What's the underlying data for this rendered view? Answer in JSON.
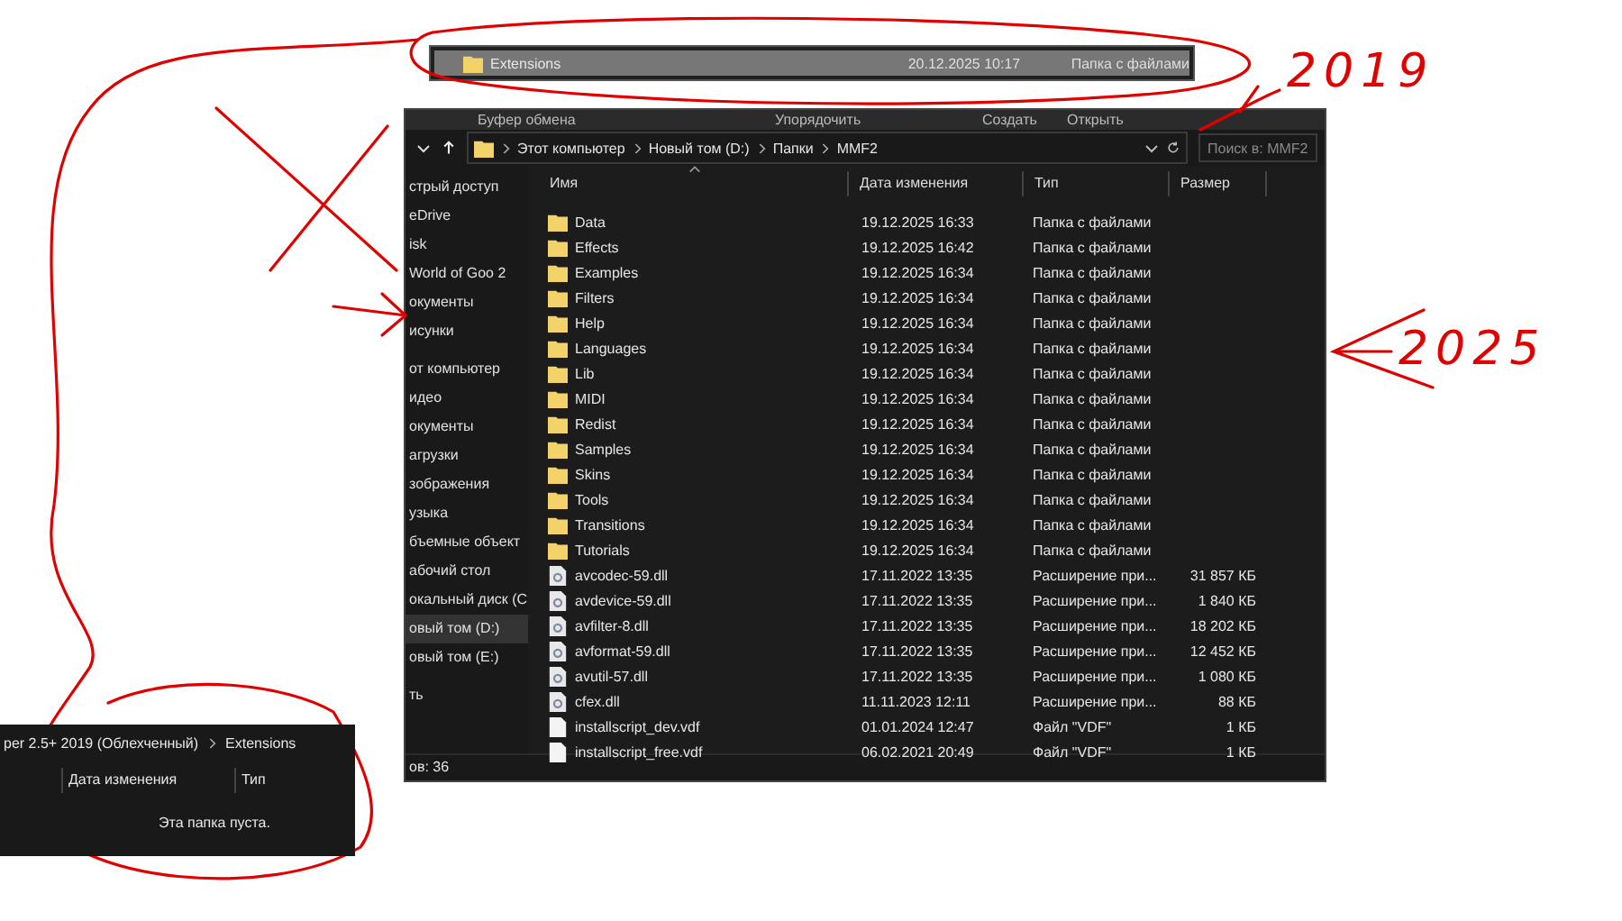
{
  "top_strip": {
    "name": "Extensions",
    "date": "20.12.2025 10:17",
    "type": "Папка с файлами",
    "selected": true
  },
  "annotations": [
    "2019",
    "2025"
  ],
  "main_window": {
    "ribbon_groups": [
      "Буфер обмена",
      "Упорядочить",
      "Создать",
      "Открыть"
    ],
    "breadcrumb": [
      "Этот компьютер",
      "Новый том (D:)",
      "Папки",
      "MMF2"
    ],
    "search": {
      "placeholder": "Поиск в: MMF2"
    },
    "sidebar": [
      {
        "label": "стрый доступ",
        "selected": false
      },
      {
        "label": "eDrive",
        "selected": false
      },
      {
        "label": "isk",
        "selected": false
      },
      {
        "label": "World of Goo 2",
        "selected": false
      },
      {
        "label": "окументы",
        "selected": false
      },
      {
        "label": "исунки",
        "selected": false
      },
      {
        "label": "от компьютер",
        "selected": false
      },
      {
        "label": "идео",
        "selected": false
      },
      {
        "label": "окументы",
        "selected": false
      },
      {
        "label": "агрузки",
        "selected": false
      },
      {
        "label": "зображения",
        "selected": false
      },
      {
        "label": "узыка",
        "selected": false
      },
      {
        "label": "бъемные объект",
        "selected": false
      },
      {
        "label": "абочий стол",
        "selected": false
      },
      {
        "label": "окальный диск (С",
        "selected": false
      },
      {
        "label": "овый том (D:)",
        "selected": true
      },
      {
        "label": "овый том (E:)",
        "selected": false
      },
      {
        "label": "ть",
        "selected": false
      }
    ],
    "columns": [
      "Имя",
      "Дата изменения",
      "Тип",
      "Размер"
    ],
    "rows": [
      {
        "kind": "folder",
        "name": "Data",
        "date": "19.12.2025 16:33",
        "type": "Папка с файлами"
      },
      {
        "kind": "folder",
        "name": "Effects",
        "date": "19.12.2025 16:42",
        "type": "Папка с файлами"
      },
      {
        "kind": "folder",
        "name": "Examples",
        "date": "19.12.2025 16:34",
        "type": "Папка с файлами"
      },
      {
        "kind": "folder",
        "name": "Filters",
        "date": "19.12.2025 16:34",
        "type": "Папка с файлами"
      },
      {
        "kind": "folder",
        "name": "Help",
        "date": "19.12.2025 16:34",
        "type": "Папка с файлами"
      },
      {
        "kind": "folder",
        "name": "Languages",
        "date": "19.12.2025 16:34",
        "type": "Папка с файлами"
      },
      {
        "kind": "folder",
        "name": "Lib",
        "date": "19.12.2025 16:34",
        "type": "Папка с файлами"
      },
      {
        "kind": "folder",
        "name": "MIDI",
        "date": "19.12.2025 16:34",
        "type": "Папка с файлами"
      },
      {
        "kind": "folder",
        "name": "Redist",
        "date": "19.12.2025 16:34",
        "type": "Папка с файлами"
      },
      {
        "kind": "folder",
        "name": "Samples",
        "date": "19.12.2025 16:34",
        "type": "Папка с файлами"
      },
      {
        "kind": "folder",
        "name": "Skins",
        "date": "19.12.2025 16:34",
        "type": "Папка с файлами"
      },
      {
        "kind": "folder",
        "name": "Tools",
        "date": "19.12.2025 16:34",
        "type": "Папка с файлами"
      },
      {
        "kind": "folder",
        "name": "Transitions",
        "date": "19.12.2025 16:34",
        "type": "Папка с файлами"
      },
      {
        "kind": "folder",
        "name": "Tutorials",
        "date": "19.12.2025 16:34",
        "type": "Папка с файлами"
      },
      {
        "kind": "dll",
        "name": "avcodec-59.dll",
        "date": "17.11.2022 13:35",
        "type": "Расширение при...",
        "size": "31 857 КБ"
      },
      {
        "kind": "dll",
        "name": "avdevice-59.dll",
        "date": "17.11.2022 13:35",
        "type": "Расширение при...",
        "size": "1 840 КБ"
      },
      {
        "kind": "dll",
        "name": "avfilter-8.dll",
        "date": "17.11.2022 13:35",
        "type": "Расширение при...",
        "size": "18 202 КБ"
      },
      {
        "kind": "dll",
        "name": "avformat-59.dll",
        "date": "17.11.2022 13:35",
        "type": "Расширение при...",
        "size": "12 452 КБ"
      },
      {
        "kind": "dll",
        "name": "avutil-57.dll",
        "date": "17.11.2022 13:35",
        "type": "Расширение при...",
        "size": "1 080 КБ"
      },
      {
        "kind": "dll",
        "name": "cfex.dll",
        "date": "11.11.2023 12:11",
        "type": "Расширение при...",
        "size": "88 КБ"
      },
      {
        "kind": "file",
        "name": "installscript_dev.vdf",
        "date": "01.01.2024 12:47",
        "type": "Файл \"VDF\"",
        "size": "1 КБ"
      },
      {
        "kind": "file",
        "name": "installscript_free.vdf",
        "date": "06.02.2021 20:49",
        "type": "Файл \"VDF\"",
        "size": "1 КБ"
      }
    ],
    "status": "ов: 36"
  },
  "small_window": {
    "breadcrumb": [
      "per 2.5+ 2019 (Облехченный)",
      "Extensions"
    ],
    "columns": [
      "Дата изменения",
      "Тип"
    ],
    "empty_message": "Эта папка пуста."
  }
}
